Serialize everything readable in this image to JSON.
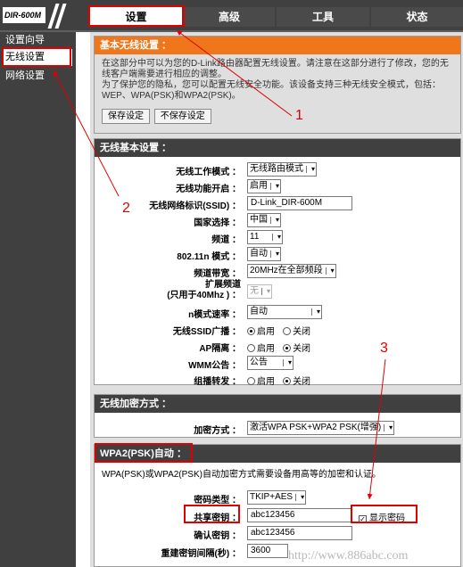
{
  "brand": {
    "logo": "DIR-600M"
  },
  "nav": {
    "tabs": [
      "设置",
      "高级",
      "工具",
      "状态"
    ]
  },
  "sidebar": {
    "items": [
      "设置向导",
      "无线设置",
      "网络设置"
    ]
  },
  "intro": {
    "title": "基本无线设置 ：",
    "paragraph1": "在这部分中可以为您的D-Link路由器配置无线设置。请注意在这部分进行了修改，您的无线客户端需要进行相应的调整。",
    "paragraph2": "为了保护您的隐私，您可以配置无线安全功能。该设备支持三种无线安全模式，包括：WEP、WPA(PSK)和WPA2(PSK)。",
    "save_label": "保存设定",
    "nosave_label": "不保存设定"
  },
  "basic": {
    "title": "无线基本设置 ：",
    "mode": {
      "label": "无线工作模式 ：",
      "value": "无线路由模式"
    },
    "enable": {
      "label": "无线功能开启 ：",
      "value": "启用"
    },
    "ssid": {
      "label": "无线网络标识(SSID) ：",
      "value": "D-Link_DIR-600M"
    },
    "country": {
      "label": "国家选择 ：",
      "value": "中国"
    },
    "channel": {
      "label": "频道 ：",
      "value": "11"
    },
    "n_mode": {
      "label": "802.11n 模式 ：",
      "value": "自动"
    },
    "bandwidth": {
      "label": "频道带宽 ：",
      "value": "20MHz在全部频段"
    },
    "ext_channel": {
      "label_line1": "扩展频道",
      "label_line2": "(只用于40Mhz ) ：",
      "value": "无"
    },
    "n_rate": {
      "label": "n模式速率 ：",
      "value": "自动"
    },
    "ssid_broadcast": {
      "label": "无线SSID广播 ：",
      "opt_on": "启用",
      "opt_off": "关闭",
      "selected": "on"
    },
    "ap_isolation": {
      "label": "AP隔离 ：",
      "opt_on": "启用",
      "opt_off": "关闭",
      "selected": "off"
    },
    "wmm": {
      "label": "WMM公告 ：",
      "value": "公告"
    },
    "multicast": {
      "label": "组播转发 ：",
      "opt_on": "启用",
      "opt_off": "关闭",
      "selected": "off"
    }
  },
  "encryption": {
    "title": "无线加密方式 ：",
    "label": "加密方式 ：",
    "value": "激活WPA PSK+WPA2 PSK(增强)"
  },
  "wpa": {
    "title": "WPA2(PSK)自动 ：",
    "desc": "WPA(PSK)或WPA2(PSK)自动加密方式需要设备用高等的加密和认证。",
    "cipher": {
      "label": "密码类型 ：",
      "value": "TKIP+AES"
    },
    "psk": {
      "label": "共享密钥",
      "colon": " ：",
      "value": "abc123456"
    },
    "show_pw": {
      "label": "显示密码",
      "checked": true
    },
    "confirm": {
      "label": "确认密钥 ：",
      "value": "abc123456"
    },
    "rekey": {
      "label": "重建密钥间隔(秒) ：",
      "value": "3600"
    }
  },
  "annotations": {
    "a1": "1",
    "a2": "2",
    "a3": "3"
  },
  "watermark": "http://www.886abc.com",
  "colors": {
    "header_dark": "#404040",
    "accent_orange": "#f0761c",
    "annotation_red": "#e00000"
  }
}
